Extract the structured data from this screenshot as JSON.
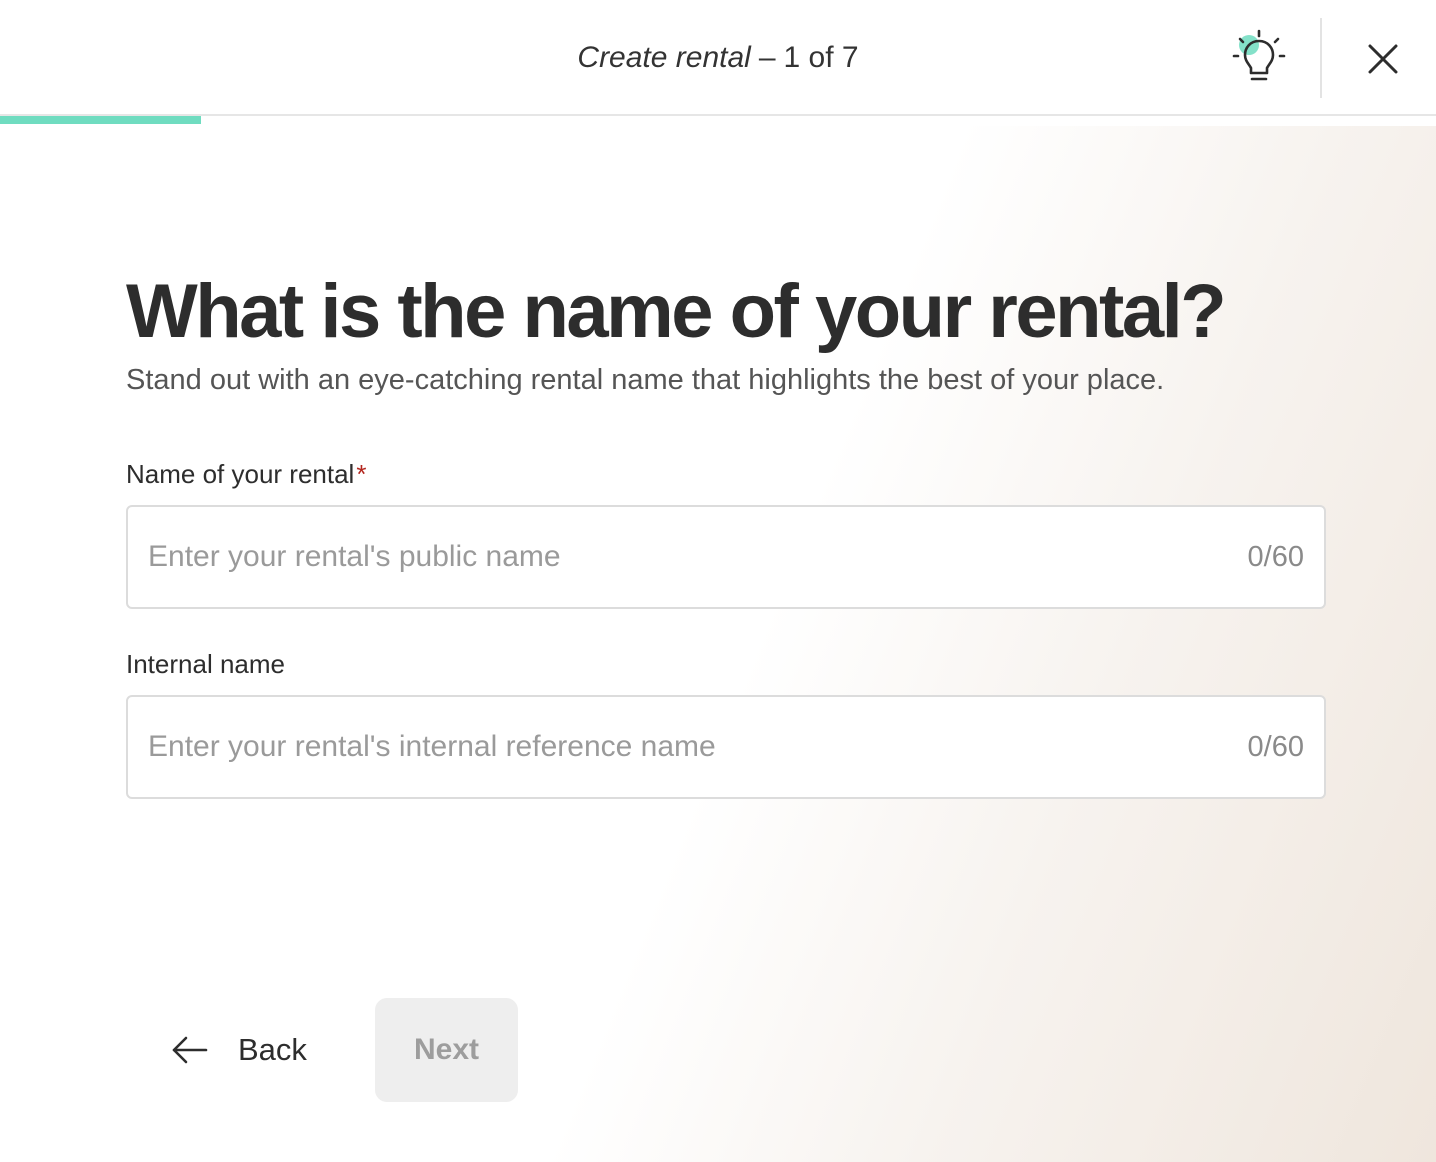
{
  "header": {
    "flow_name": "Create rental",
    "separator": "–",
    "step_text": "1 of 7",
    "tips_icon": "lightbulb-icon",
    "close_icon": "close-icon"
  },
  "progress": {
    "current_step": 1,
    "total_steps": 7,
    "fill_fraction": 0.14,
    "color": "#6fdcc0"
  },
  "main": {
    "title": "What is the name of your rental?",
    "subtitle": "Stand out with an eye-catching rental name that highlights the best of your place."
  },
  "fields": {
    "public_name": {
      "label": "Name of your rental",
      "required_mark": "*",
      "value": "",
      "placeholder": "Enter your rental's public name",
      "counter": "0/60"
    },
    "internal_name": {
      "label": "Internal name",
      "value": "",
      "placeholder": "Enter your rental's internal reference name",
      "counter": "0/60"
    }
  },
  "footer": {
    "back_label": "Back",
    "back_icon": "arrow-left-icon",
    "next_label": "Next",
    "next_disabled": true
  },
  "colors": {
    "accent": "#6fdcc0",
    "required": "#b3261e",
    "text": "#2d2d2d",
    "disabled_bg": "#eeeeee",
    "disabled_text": "#9d9d9d"
  }
}
